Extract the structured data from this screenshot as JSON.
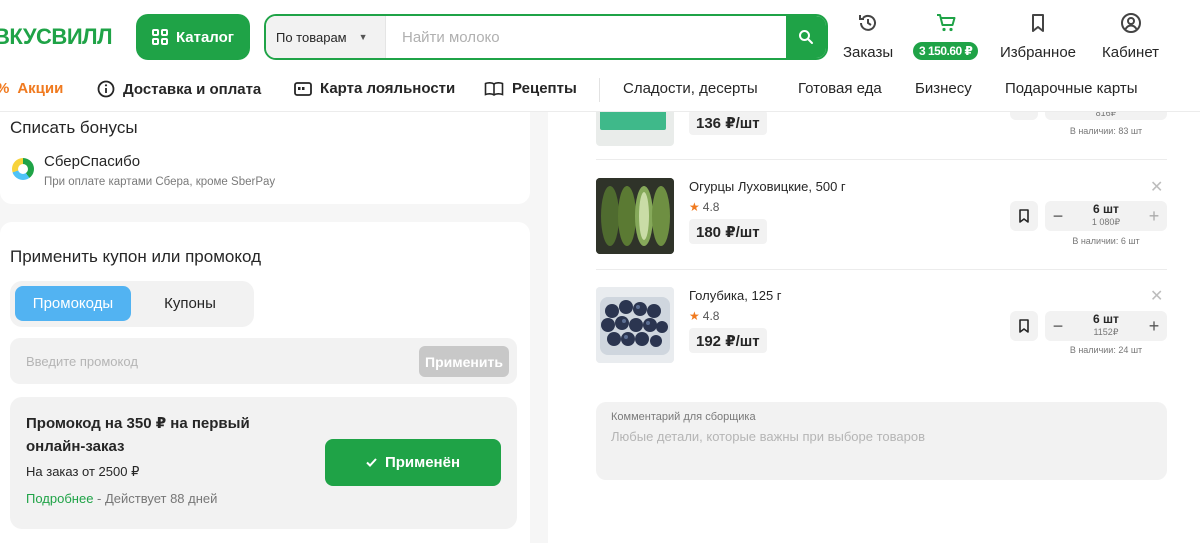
{
  "header": {
    "logo": "ВКУСВИЛЛ",
    "catalog_label": "Каталог",
    "search": {
      "scope": "По товарам",
      "placeholder": "Найти молоко"
    },
    "orders_label": "Заказы",
    "cart_total": "3 150.60 ₽",
    "favorites_label": "Избранное",
    "cabinet_label": "Кабинет"
  },
  "nav": {
    "promo": "Акции",
    "delivery": "Доставка и оплата",
    "loyalty": "Карта лояльности",
    "recipes": "Рецепты",
    "sweets": "Сладости, десерты",
    "ready_food": "Готовая еда",
    "business": "Бизнесу",
    "gift_cards": "Подарочные карты"
  },
  "bonuses": {
    "title": "Списать бонусы",
    "sber_name": "СберСпасибо",
    "sber_note": "При оплате картами Сбера, кроме SberPay"
  },
  "coupon_section": {
    "title": "Применить купон или промокод",
    "tabs": [
      {
        "label": "Промокоды",
        "active": true
      },
      {
        "label": "Купоны",
        "active": false
      }
    ],
    "input_placeholder": "Введите промокод",
    "apply_label": "Применить",
    "coupon": {
      "title_line1": "Промокод на 350 ₽ на первый",
      "title_line2": "онлайн-заказ",
      "condition": "На заказ от 2500 ₽",
      "more_link": "Подробнее",
      "validity": " - Действует 88 дней",
      "button_label": "Применён"
    }
  },
  "cart": {
    "items": [
      {
        "name": "",
        "price": "136 ₽/шт",
        "sum": "816₽",
        "stock": "В наличии: 83 шт"
      },
      {
        "name": "Огурцы Луховицкие, 500 г",
        "rating": "4.8",
        "price": "180 ₽/шт",
        "count": "6 шт",
        "sum": "1 080₽",
        "stock": "В наличии: 6 шт"
      },
      {
        "name": "Голубика, 125 г",
        "rating": "4.8",
        "price": "192 ₽/шт",
        "count": "6 шт",
        "sum": "1152₽",
        "stock": "В наличии: 24 шт"
      }
    ],
    "comment": {
      "label": "Комментарий для сборщика",
      "placeholder": "Любые детали, которые важны при выборе товаров"
    }
  },
  "colors": {
    "brand_green": "#1fa347",
    "tab_blue": "#52b3f2",
    "promo_orange": "#f07a1f"
  }
}
